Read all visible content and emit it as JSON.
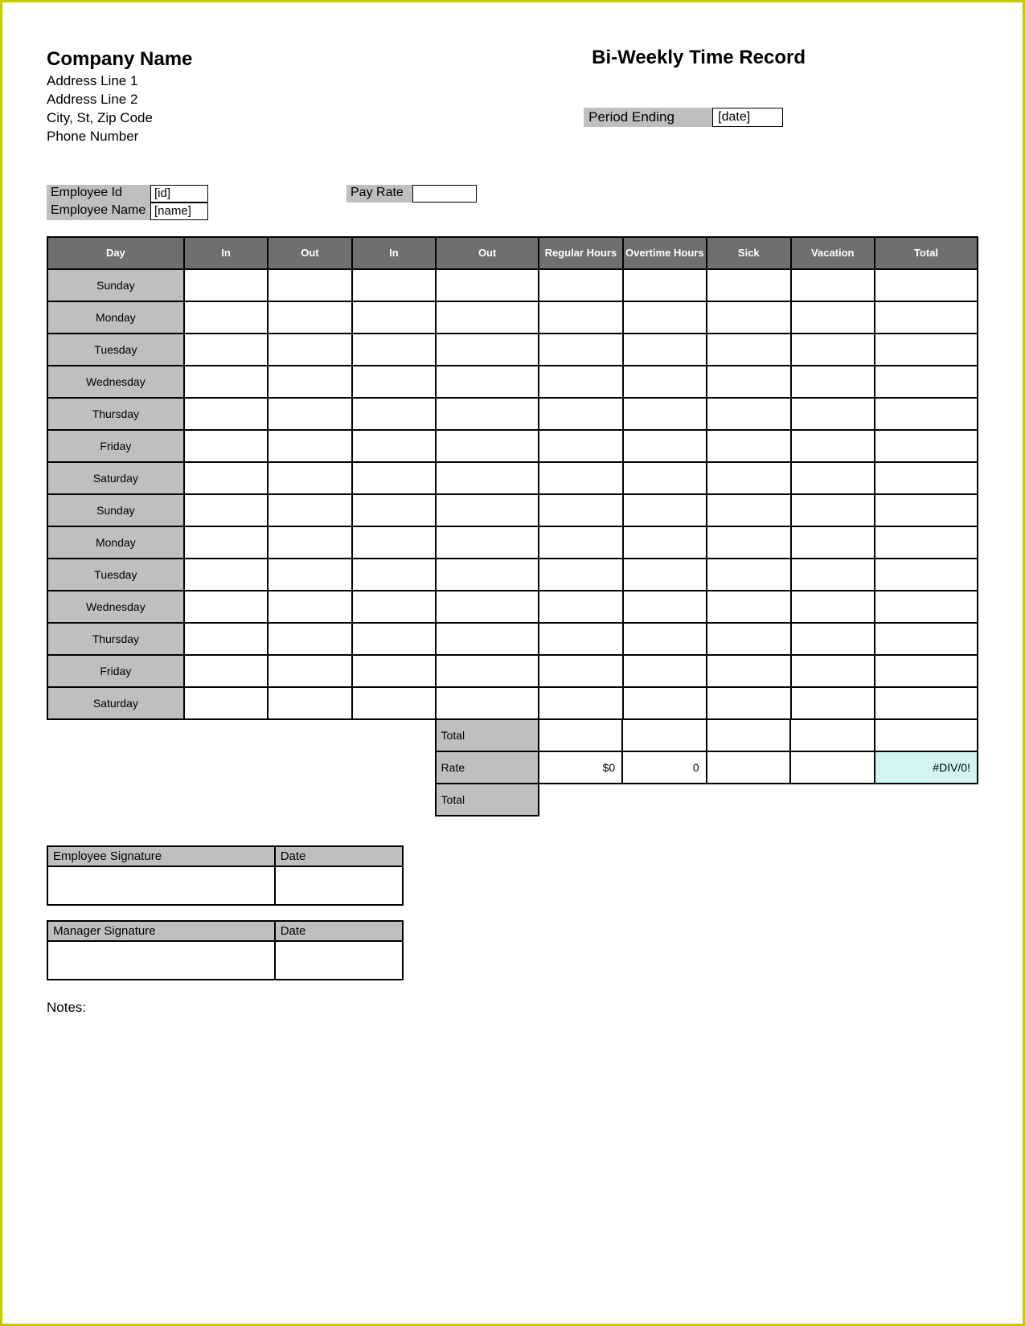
{
  "company": {
    "name": "Company Name",
    "line1": "Address Line 1",
    "line2": "Address Line 2",
    "city": "City, St, Zip Code",
    "phone": "Phone Number"
  },
  "title": "Bi-Weekly Time Record",
  "period": {
    "label": "Period Ending",
    "value": "[date]"
  },
  "employee": {
    "id_label": "Employee Id",
    "id_value": "[id]",
    "name_label": "Employee Name",
    "name_value": "[name]"
  },
  "pay": {
    "label": "Pay Rate",
    "value": ""
  },
  "headers": {
    "day": "Day",
    "in1": "In",
    "out1": "Out",
    "in2": "In",
    "out2": "Out",
    "regular": "Regular Hours",
    "overtime": "Overtime Hours",
    "sick": "Sick",
    "vacation": "Vacation",
    "total": "Total"
  },
  "days": [
    "Sunday",
    "Monday",
    "Tuesday",
    "Wednesday",
    "Thursday",
    "Friday",
    "Saturday",
    "Sunday",
    "Monday",
    "Tuesday",
    "Wednesday",
    "Thursday",
    "Friday",
    "Saturday"
  ],
  "totals": {
    "total1_label": "Total",
    "rate_label": "Rate",
    "total2_label": "Total",
    "rate_regular": "$0",
    "rate_overtime": "0",
    "rate_total_error": "#DIV/0!"
  },
  "signatures": {
    "employee_label": "Employee Signature",
    "manager_label": "Manager Signature",
    "date_label": "Date"
  },
  "notes_label": "Notes:"
}
